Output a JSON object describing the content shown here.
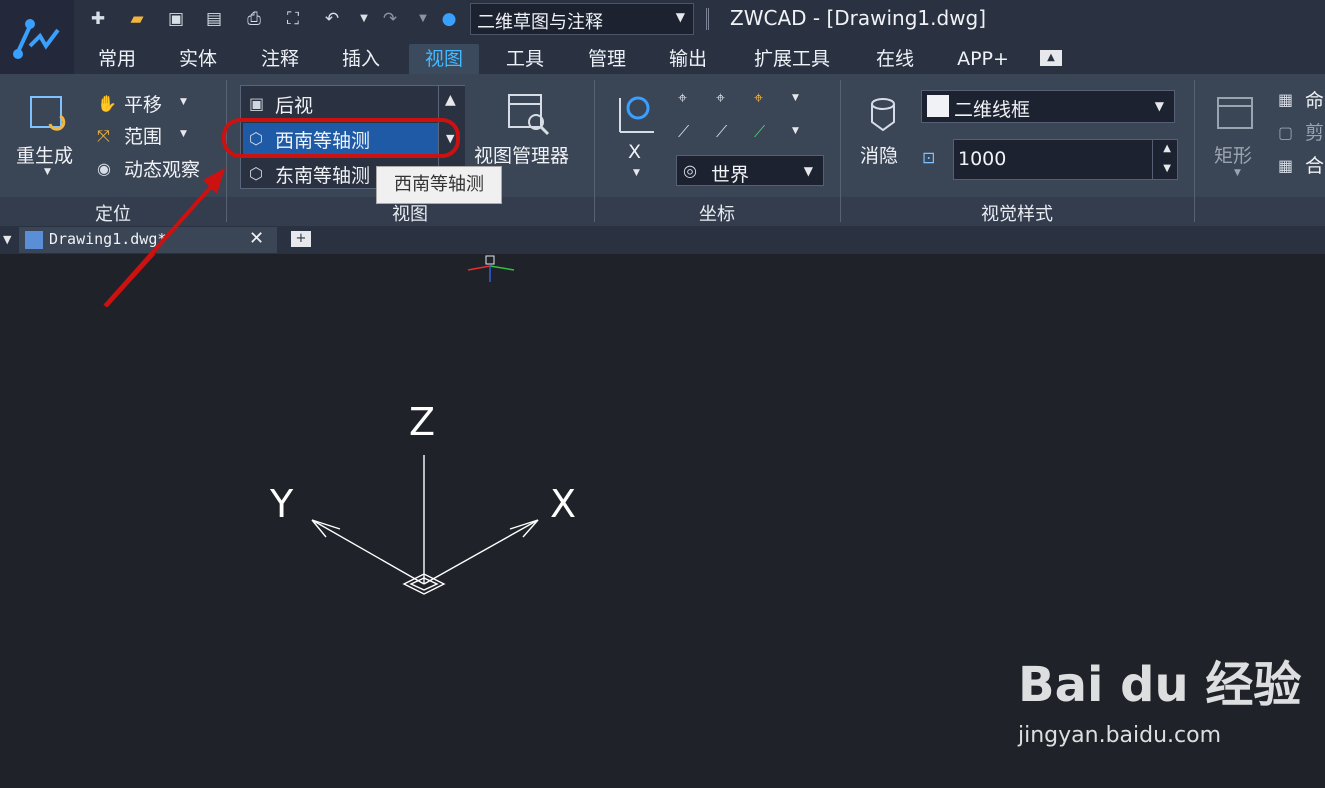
{
  "quick_access": {
    "icons": [
      "new-icon",
      "open-folder-icon",
      "save-icon",
      "save-as-icon",
      "print-icon",
      "zoom-extents-icon",
      "undo-icon",
      "undo-dropdown-icon",
      "redo-icon",
      "redo-dropdown-icon",
      "help-icon"
    ],
    "workspace": "二维草图与注释",
    "window_title": "ZWCAD - [Drawing1.dwg]"
  },
  "tabs": [
    {
      "label": "常用"
    },
    {
      "label": "实体"
    },
    {
      "label": "注释"
    },
    {
      "label": "插入"
    },
    {
      "label": "视图",
      "active": true
    },
    {
      "label": "工具"
    },
    {
      "label": "管理"
    },
    {
      "label": "输出"
    },
    {
      "label": "扩展工具"
    },
    {
      "label": "在线"
    },
    {
      "label": "APP+"
    }
  ],
  "ribbon": {
    "navigate": {
      "title": "定位",
      "regen": "重生成",
      "pan": "平移",
      "extent": "范围",
      "orbit": "动态观察"
    },
    "views": {
      "title": "视图",
      "items": [
        {
          "label": "后视"
        },
        {
          "label": "西南等轴测",
          "selected": true
        },
        {
          "label": "东南等轴测"
        }
      ],
      "tooltip": "西南等轴测",
      "view_manager": "视图管理器"
    },
    "coords": {
      "title": "坐标",
      "axis_label": "X",
      "ucs": "世界"
    },
    "visual_styles": {
      "title": "视觉样式",
      "hide": "消隐",
      "style": "二维线框",
      "value": "1000"
    },
    "extra": {
      "rect": "矩形",
      "cmd1": "命",
      "cmd2": "剪",
      "cmd3": "合"
    }
  },
  "document": {
    "tab_label": "Drawing1.dwg*"
  },
  "ucs_icon": {
    "z": "Z",
    "y": "Y",
    "x": "X"
  },
  "watermark": {
    "brand": "Bai du 经验",
    "url": "jingyan.baidu.com"
  },
  "colors": {
    "accent": "#43b9ff",
    "selection": "#1e5aa6",
    "highlight_ring": "#cc1111",
    "arrow": "#cc1111"
  }
}
